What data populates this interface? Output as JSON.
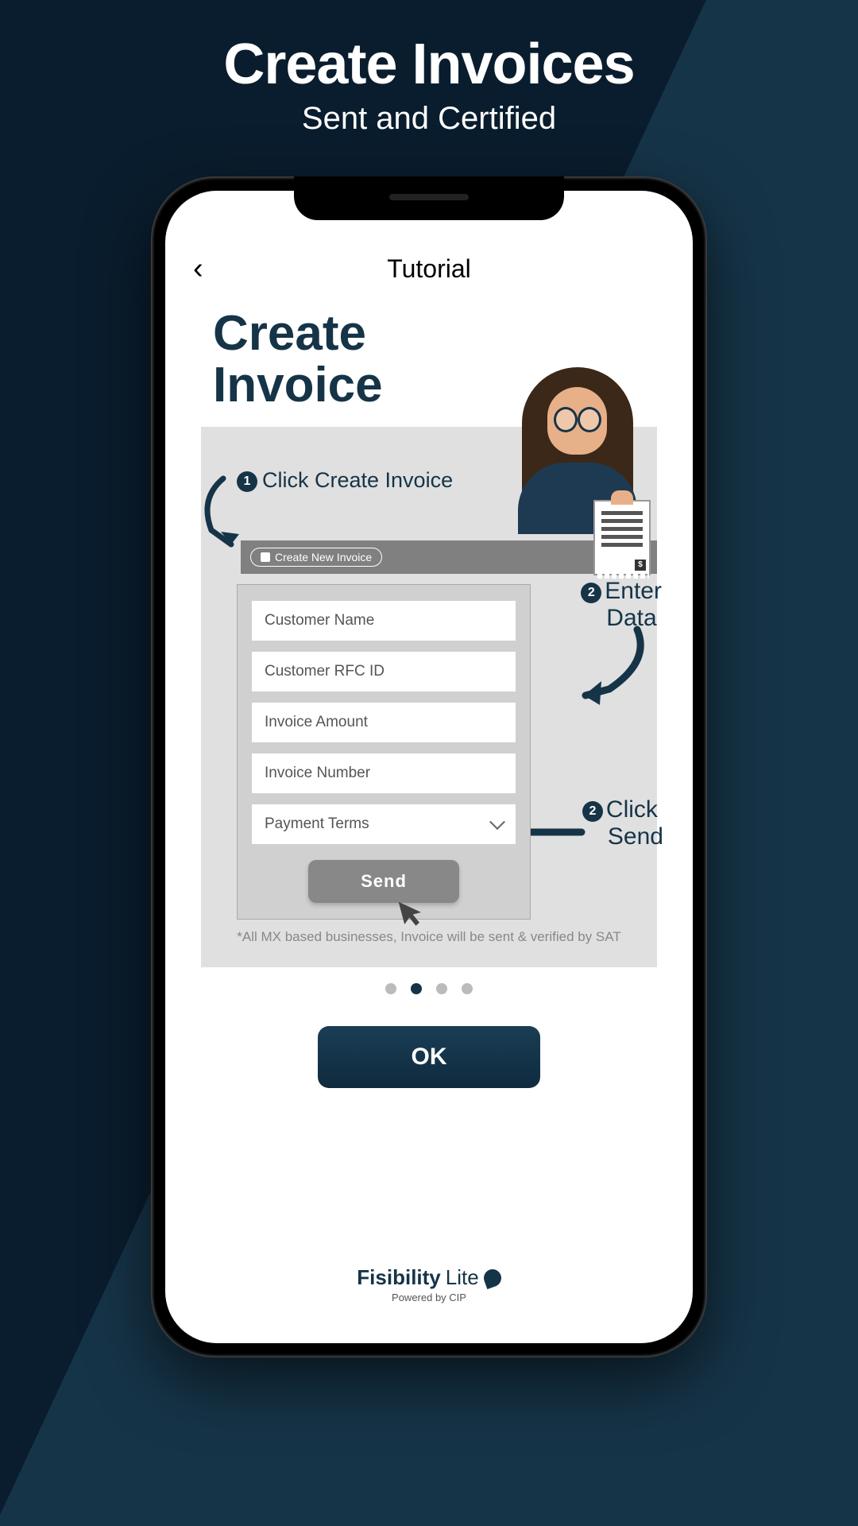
{
  "header": {
    "title": "Create Invoices",
    "subtitle": "Sent and Certified"
  },
  "screen": {
    "nav_title": "Tutorial",
    "content_title_line1": "Create",
    "content_title_line2": "Invoice",
    "steps": {
      "one": {
        "num": "1",
        "text": "Click Create Invoice"
      },
      "two": {
        "num": "2",
        "text_line1": "Enter",
        "text_line2": "Data"
      },
      "three": {
        "num": "2",
        "text_line1": "Click",
        "text_line2": "Send"
      }
    },
    "create_button_label": "Create New Invoice",
    "form": {
      "customer_name": "Customer Name",
      "customer_rfc": "Customer RFC ID",
      "invoice_amount": "Invoice Amount",
      "invoice_number": "Invoice Number",
      "payment_terms": "Payment Terms",
      "send_label": "Send"
    },
    "footnote": "*All MX based businesses, Invoice will be sent & verified by SAT",
    "receipt_symbol": "$",
    "pagination": {
      "count": 4,
      "active_index": 1
    },
    "ok_button": "OK",
    "brand": {
      "name_part1": "Fisibility",
      "name_part2": "Lite",
      "powered_by": "Powered by CIP"
    }
  }
}
